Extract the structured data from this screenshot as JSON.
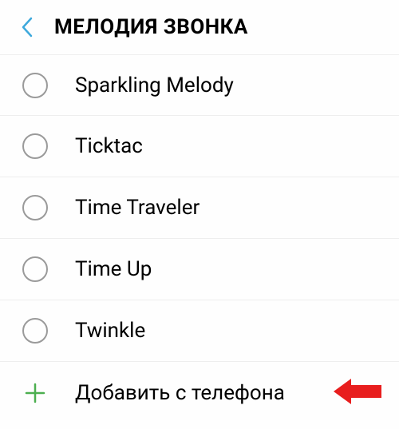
{
  "header": {
    "title": "МЕЛОДИЯ ЗВОНКА"
  },
  "ringtones": [
    {
      "label": "Sparkling Melody"
    },
    {
      "label": "Ticktac"
    },
    {
      "label": "Time Traveler"
    },
    {
      "label": "Time Up"
    },
    {
      "label": "Twinkle"
    }
  ],
  "add_action": {
    "label": "Добавить с телефона"
  }
}
